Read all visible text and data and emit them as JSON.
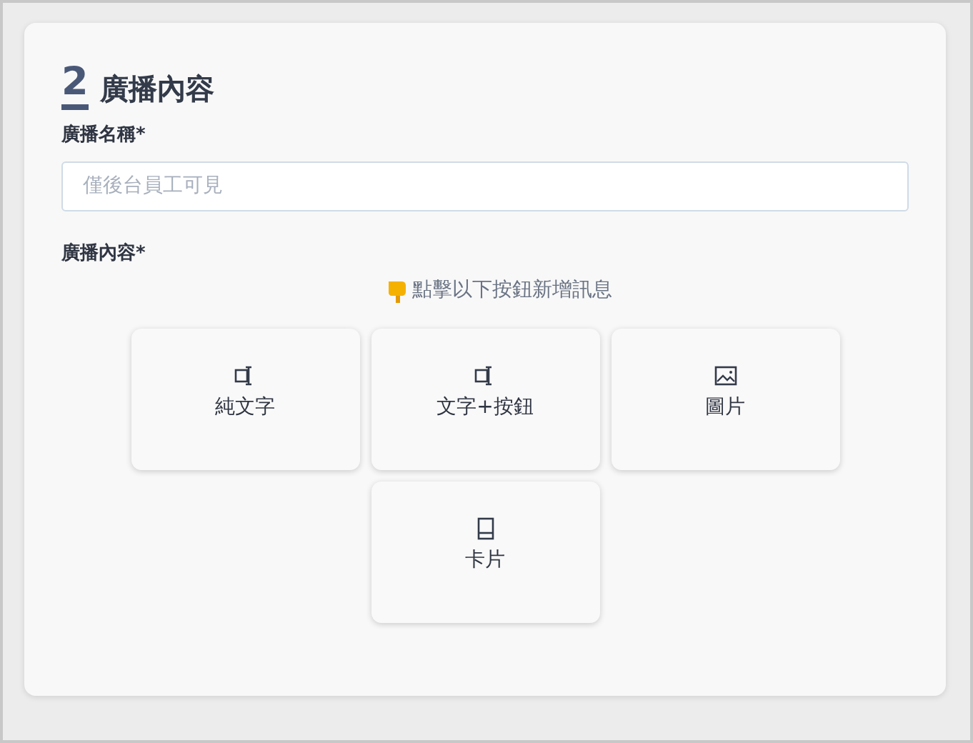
{
  "section": {
    "number": "2",
    "title": "廣播內容"
  },
  "name_field": {
    "label": "廣播名稱*",
    "placeholder": "僅後台員工可見"
  },
  "content": {
    "label": "廣播內容*",
    "hint": "點擊以下按鈕新增訊息",
    "options": [
      {
        "kind": "text",
        "label": "純文字"
      },
      {
        "kind": "text",
        "label": "文字+按鈕"
      },
      {
        "kind": "image",
        "label": "圖片"
      },
      {
        "kind": "card",
        "label": "卡片"
      }
    ]
  }
}
